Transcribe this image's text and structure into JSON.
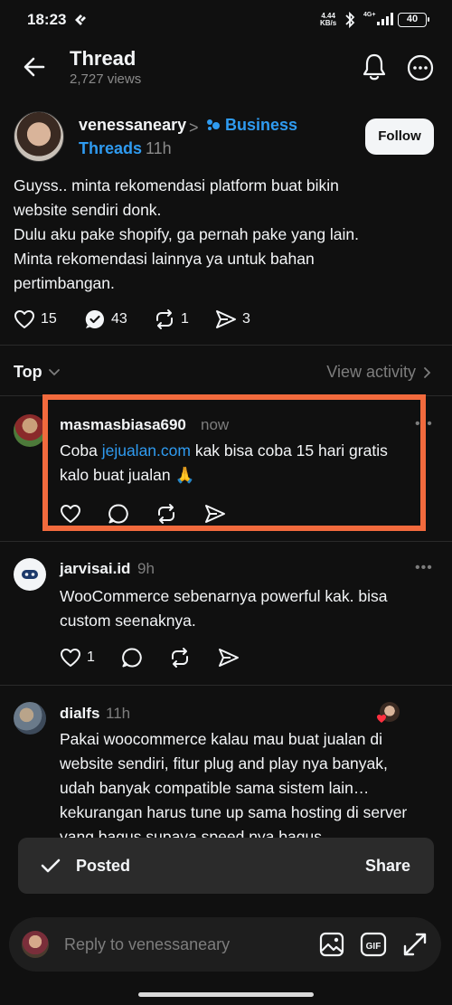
{
  "status_bar": {
    "time": "18:23",
    "net_speed_value": "4.44",
    "net_speed_unit": "KB/s",
    "network": "4G+",
    "battery": "40"
  },
  "header": {
    "title": "Thread",
    "views": "2,727 views"
  },
  "post": {
    "author": "venessaneary",
    "separator": ">",
    "tag": "Business",
    "tag_sub": "Threads",
    "time": "11h",
    "follow_label": "Follow",
    "body_lines": [
      "Guyss.. minta rekomendasi platform buat bikin",
      "website sendiri donk.",
      "Dulu aku pake shopify, ga pernah pake yang lain.",
      "Minta rekomendasi lainnya ya untuk bahan",
      "pertimbangan."
    ],
    "likes": "15",
    "replies": "43",
    "reposts": "1",
    "shares": "3"
  },
  "sort": {
    "label": "Top",
    "view_activity": "View activity"
  },
  "replies": [
    {
      "author": "masmasbiasa690",
      "time": "now",
      "text_prefix": "Coba ",
      "link": "jejualan.com",
      "text_suffix": " kak bisa coba 15 hari gratis",
      "line2": "kalo buat jualan 🙏",
      "more": "•••"
    },
    {
      "author": "jarvisai.id",
      "time": "9h",
      "lines": [
        "WooCommerce sebenarnya powerful kak. bisa",
        "custom seenaknya."
      ],
      "likes": "1",
      "more": "•••"
    },
    {
      "author": "dialfs",
      "time": "11h",
      "lines": [
        "Pakai woocommerce kalau mau buat jualan di",
        "website sendiri, fitur plug and play nya banyak,",
        "udah banyak compatible sama sistem lain…",
        "kekurangan harus tune up sama hosting di server",
        "yang bagus supaya speed nya bagus"
      ]
    }
  ],
  "toast": {
    "message": "Posted",
    "action": "Share"
  },
  "reply_bar": {
    "placeholder": "Reply to venessaneary",
    "gif_label": "GIF"
  },
  "colors": {
    "background": "#101010",
    "link": "#2f9bf0",
    "highlight": "#f26a3d",
    "muted": "#7d7d7d"
  },
  "icons": [
    "back-arrow-icon",
    "bell-icon",
    "more-circle-icon",
    "heart-icon",
    "reply-icon",
    "repost-icon",
    "share-icon",
    "check-icon",
    "image-icon",
    "gif-icon",
    "expand-icon"
  ]
}
